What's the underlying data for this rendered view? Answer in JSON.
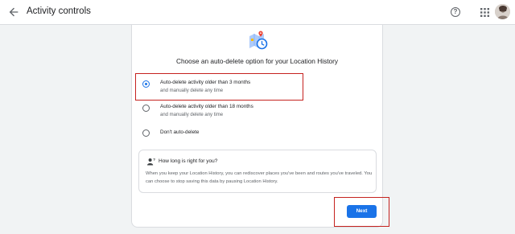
{
  "header": {
    "back_icon": "arrow-back-icon",
    "title": "Activity controls",
    "help_icon": "help-circle-icon",
    "apps_icon": "apps-grid-icon"
  },
  "card": {
    "hero_icon": "map-clock-icon",
    "heading": "Choose an auto-delete option for your Location History",
    "options": [
      {
        "label": "Auto-delete activity older than 3 months",
        "sublabel": "and manually delete any time",
        "selected": true
      },
      {
        "label": "Auto-delete activity older than 18 months",
        "sublabel": "and manually delete any time",
        "selected": false
      },
      {
        "label": "Don't auto-delete",
        "selected": false
      }
    ],
    "info": {
      "icon": "person-question-icon",
      "title": "How long is right for you?",
      "body": "When you keep your Location History, you can rediscover places you've been and routes you've traveled. You can choose to stop saving this data by pausing Location History."
    },
    "next_label": "Next"
  },
  "colors": {
    "accent": "#1a73e8",
    "highlight": "#c5221f",
    "background": "#f1f3f4"
  }
}
